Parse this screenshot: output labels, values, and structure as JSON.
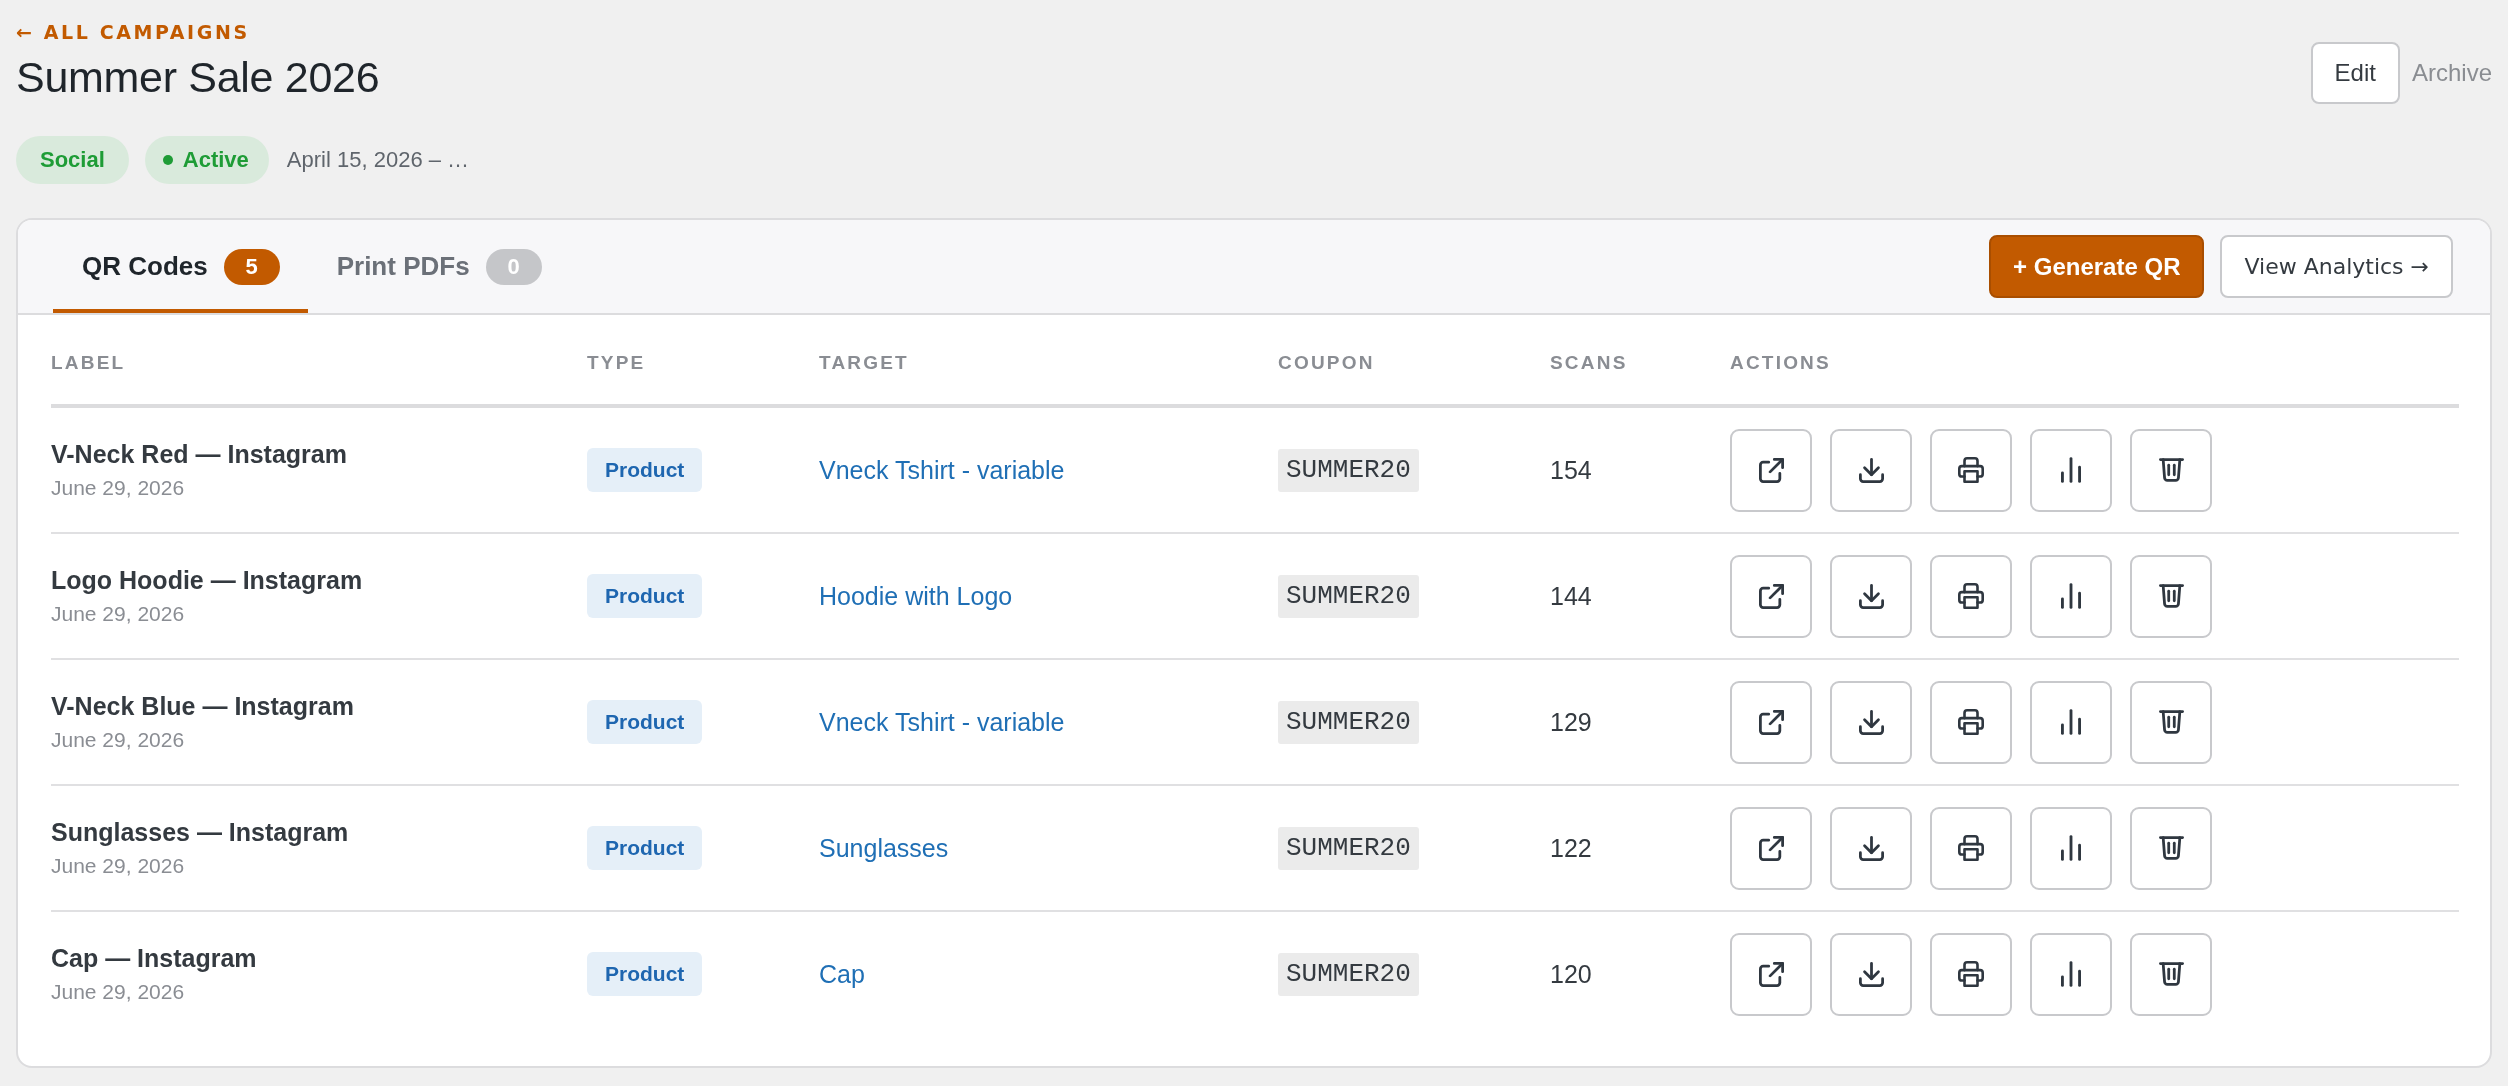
{
  "back_link": "← ALL CAMPAIGNS",
  "title": "Summer Sale 2026",
  "tags": [
    {
      "kind": "channel",
      "label": "Social"
    },
    {
      "kind": "status",
      "label": "Active"
    }
  ],
  "date_range": "April 15, 2026 – …",
  "header_actions": [
    {
      "kind": "edit",
      "label": "Edit"
    },
    {
      "kind": "archive",
      "label": "Archive"
    }
  ],
  "tabs": [
    {
      "label": "QR Codes",
      "count": "5",
      "selected": true
    },
    {
      "label": "Print PDFs",
      "count": "0",
      "selected": false
    }
  ],
  "toolbar": [
    {
      "kind": "generate",
      "label": "+ Generate QR"
    },
    {
      "kind": "analytics",
      "label": "View Analytics →"
    }
  ],
  "table": {
    "columns": [
      "LABEL",
      "TYPE",
      "TARGET",
      "COUPON",
      "SCANS",
      "ACTIONS"
    ],
    "rows": [
      {
        "label": "V-Neck Red — Instagram",
        "date": "June 29, 2026",
        "type": "Product",
        "target": "Vneck Tshirt - variable",
        "coupon": "SUMMER20",
        "scans": "154",
        "actions": [
          {
            "kind": "open"
          },
          {
            "kind": "download"
          },
          {
            "kind": "print"
          },
          {
            "kind": "stats"
          },
          {
            "kind": "delete"
          }
        ]
      },
      {
        "label": "Logo Hoodie — Instagram",
        "date": "June 29, 2026",
        "type": "Product",
        "target": "Hoodie with Logo",
        "coupon": "SUMMER20",
        "scans": "144",
        "actions": [
          {
            "kind": "open"
          },
          {
            "kind": "download"
          },
          {
            "kind": "print"
          },
          {
            "kind": "stats"
          },
          {
            "kind": "delete"
          }
        ]
      },
      {
        "label": "V-Neck Blue — Instagram",
        "date": "June 29, 2026",
        "type": "Product",
        "target": "Vneck Tshirt - variable",
        "coupon": "SUMMER20",
        "scans": "129",
        "actions": [
          {
            "kind": "open"
          },
          {
            "kind": "download"
          },
          {
            "kind": "print"
          },
          {
            "kind": "stats"
          },
          {
            "kind": "delete"
          }
        ]
      },
      {
        "label": "Sunglasses — Instagram",
        "date": "June 29, 2026",
        "type": "Product",
        "target": "Sunglasses",
        "coupon": "SUMMER20",
        "scans": "122",
        "actions": [
          {
            "kind": "open"
          },
          {
            "kind": "download"
          },
          {
            "kind": "print"
          },
          {
            "kind": "stats"
          },
          {
            "kind": "delete"
          }
        ]
      },
      {
        "label": "Cap — Instagram",
        "date": "June 29, 2026",
        "type": "Product",
        "target": "Cap",
        "coupon": "SUMMER20",
        "scans": "120",
        "actions": [
          {
            "kind": "open"
          },
          {
            "kind": "download"
          },
          {
            "kind": "print"
          },
          {
            "kind": "stats"
          },
          {
            "kind": "delete"
          }
        ]
      }
    ]
  }
}
